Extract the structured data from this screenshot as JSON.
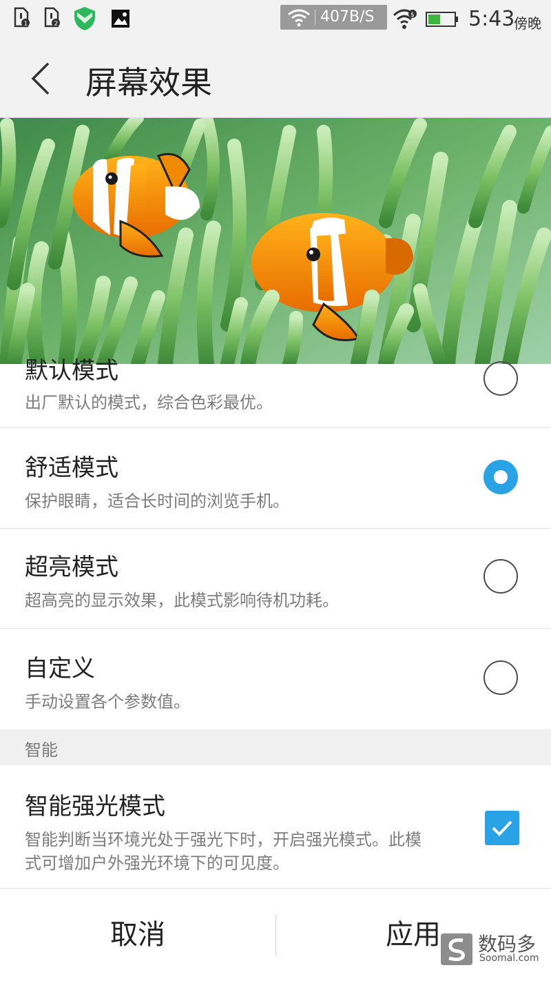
{
  "status_bar": {
    "net_speed": "407B/S",
    "time": "5:43",
    "period": "傍晚",
    "icons": [
      "sim-1-icon",
      "sim-2-icon",
      "shield-app-icon",
      "image-notification-icon",
      "wifi-icon",
      "wifi-lock-icon",
      "battery-icon"
    ]
  },
  "header": {
    "title": "屏幕效果",
    "back_icon": "chevron-left-icon"
  },
  "modes": [
    {
      "title": "默认模式",
      "desc": "出厂默认的模式，综合色彩最优。",
      "selected": false
    },
    {
      "title": "舒适模式",
      "desc": "保护眼睛，适合长时间的浏览手机。",
      "selected": true
    },
    {
      "title": "超亮模式",
      "desc": "超高亮的显示效果，此模式影响待机功耗。",
      "selected": false
    },
    {
      "title": "自定义",
      "desc": "手动设置各个参数值。",
      "selected": false
    }
  ],
  "smart": {
    "section_label": "智能",
    "title": "智能强光模式",
    "desc_line1": "智能判断当环境光处于强光下时，开启强光模式。此模",
    "desc_line2": "式可增加户外强光环境下的可见度。",
    "checked": true
  },
  "footer": {
    "cancel": "取消",
    "apply": "应用"
  },
  "watermark": {
    "name": "数码多",
    "domain": "Soomal.com"
  },
  "colors": {
    "accent": "#29a3e6",
    "status_bg": "#f2f2f2",
    "battery": "#3db53d"
  }
}
